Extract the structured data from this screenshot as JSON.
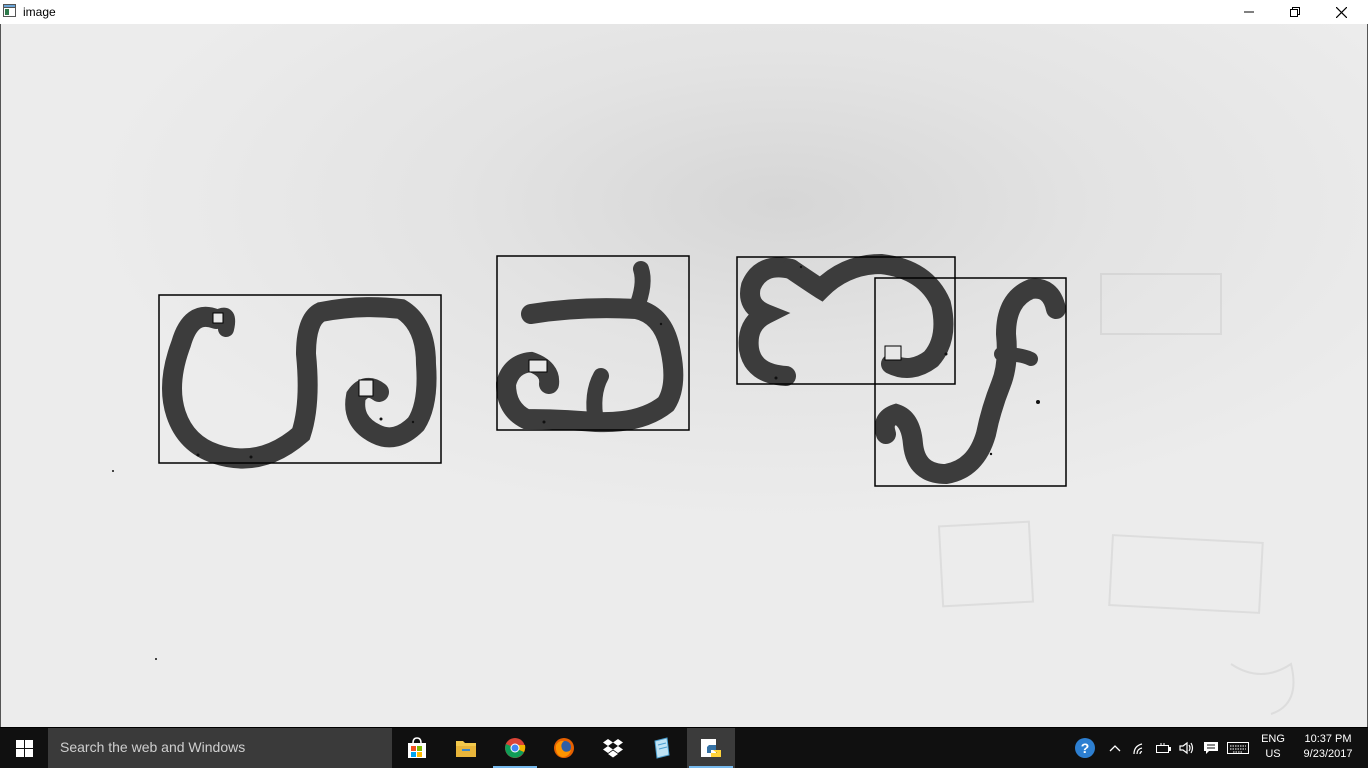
{
  "window": {
    "title": "image",
    "minimize_icon": "minimize-icon",
    "maximize_icon": "restore-icon",
    "close_icon": "close-icon"
  },
  "canvas": {
    "description_icon": "handwritten-characters-with-bounding-boxes",
    "box_color": "#000000",
    "stroke_color": "#3c3c3c"
  },
  "taskbar": {
    "search_placeholder": "Search the web and Windows",
    "apps": [
      "store-icon",
      "file-explorer-icon",
      "chrome-icon",
      "firefox-icon",
      "dropbox-icon",
      "notepad-icon",
      "python-icon"
    ],
    "language": {
      "line1": "ENG",
      "line2": "US"
    },
    "clock": {
      "time": "10:37 PM",
      "date": "9/23/2017"
    },
    "accent": "#76b9ed"
  }
}
